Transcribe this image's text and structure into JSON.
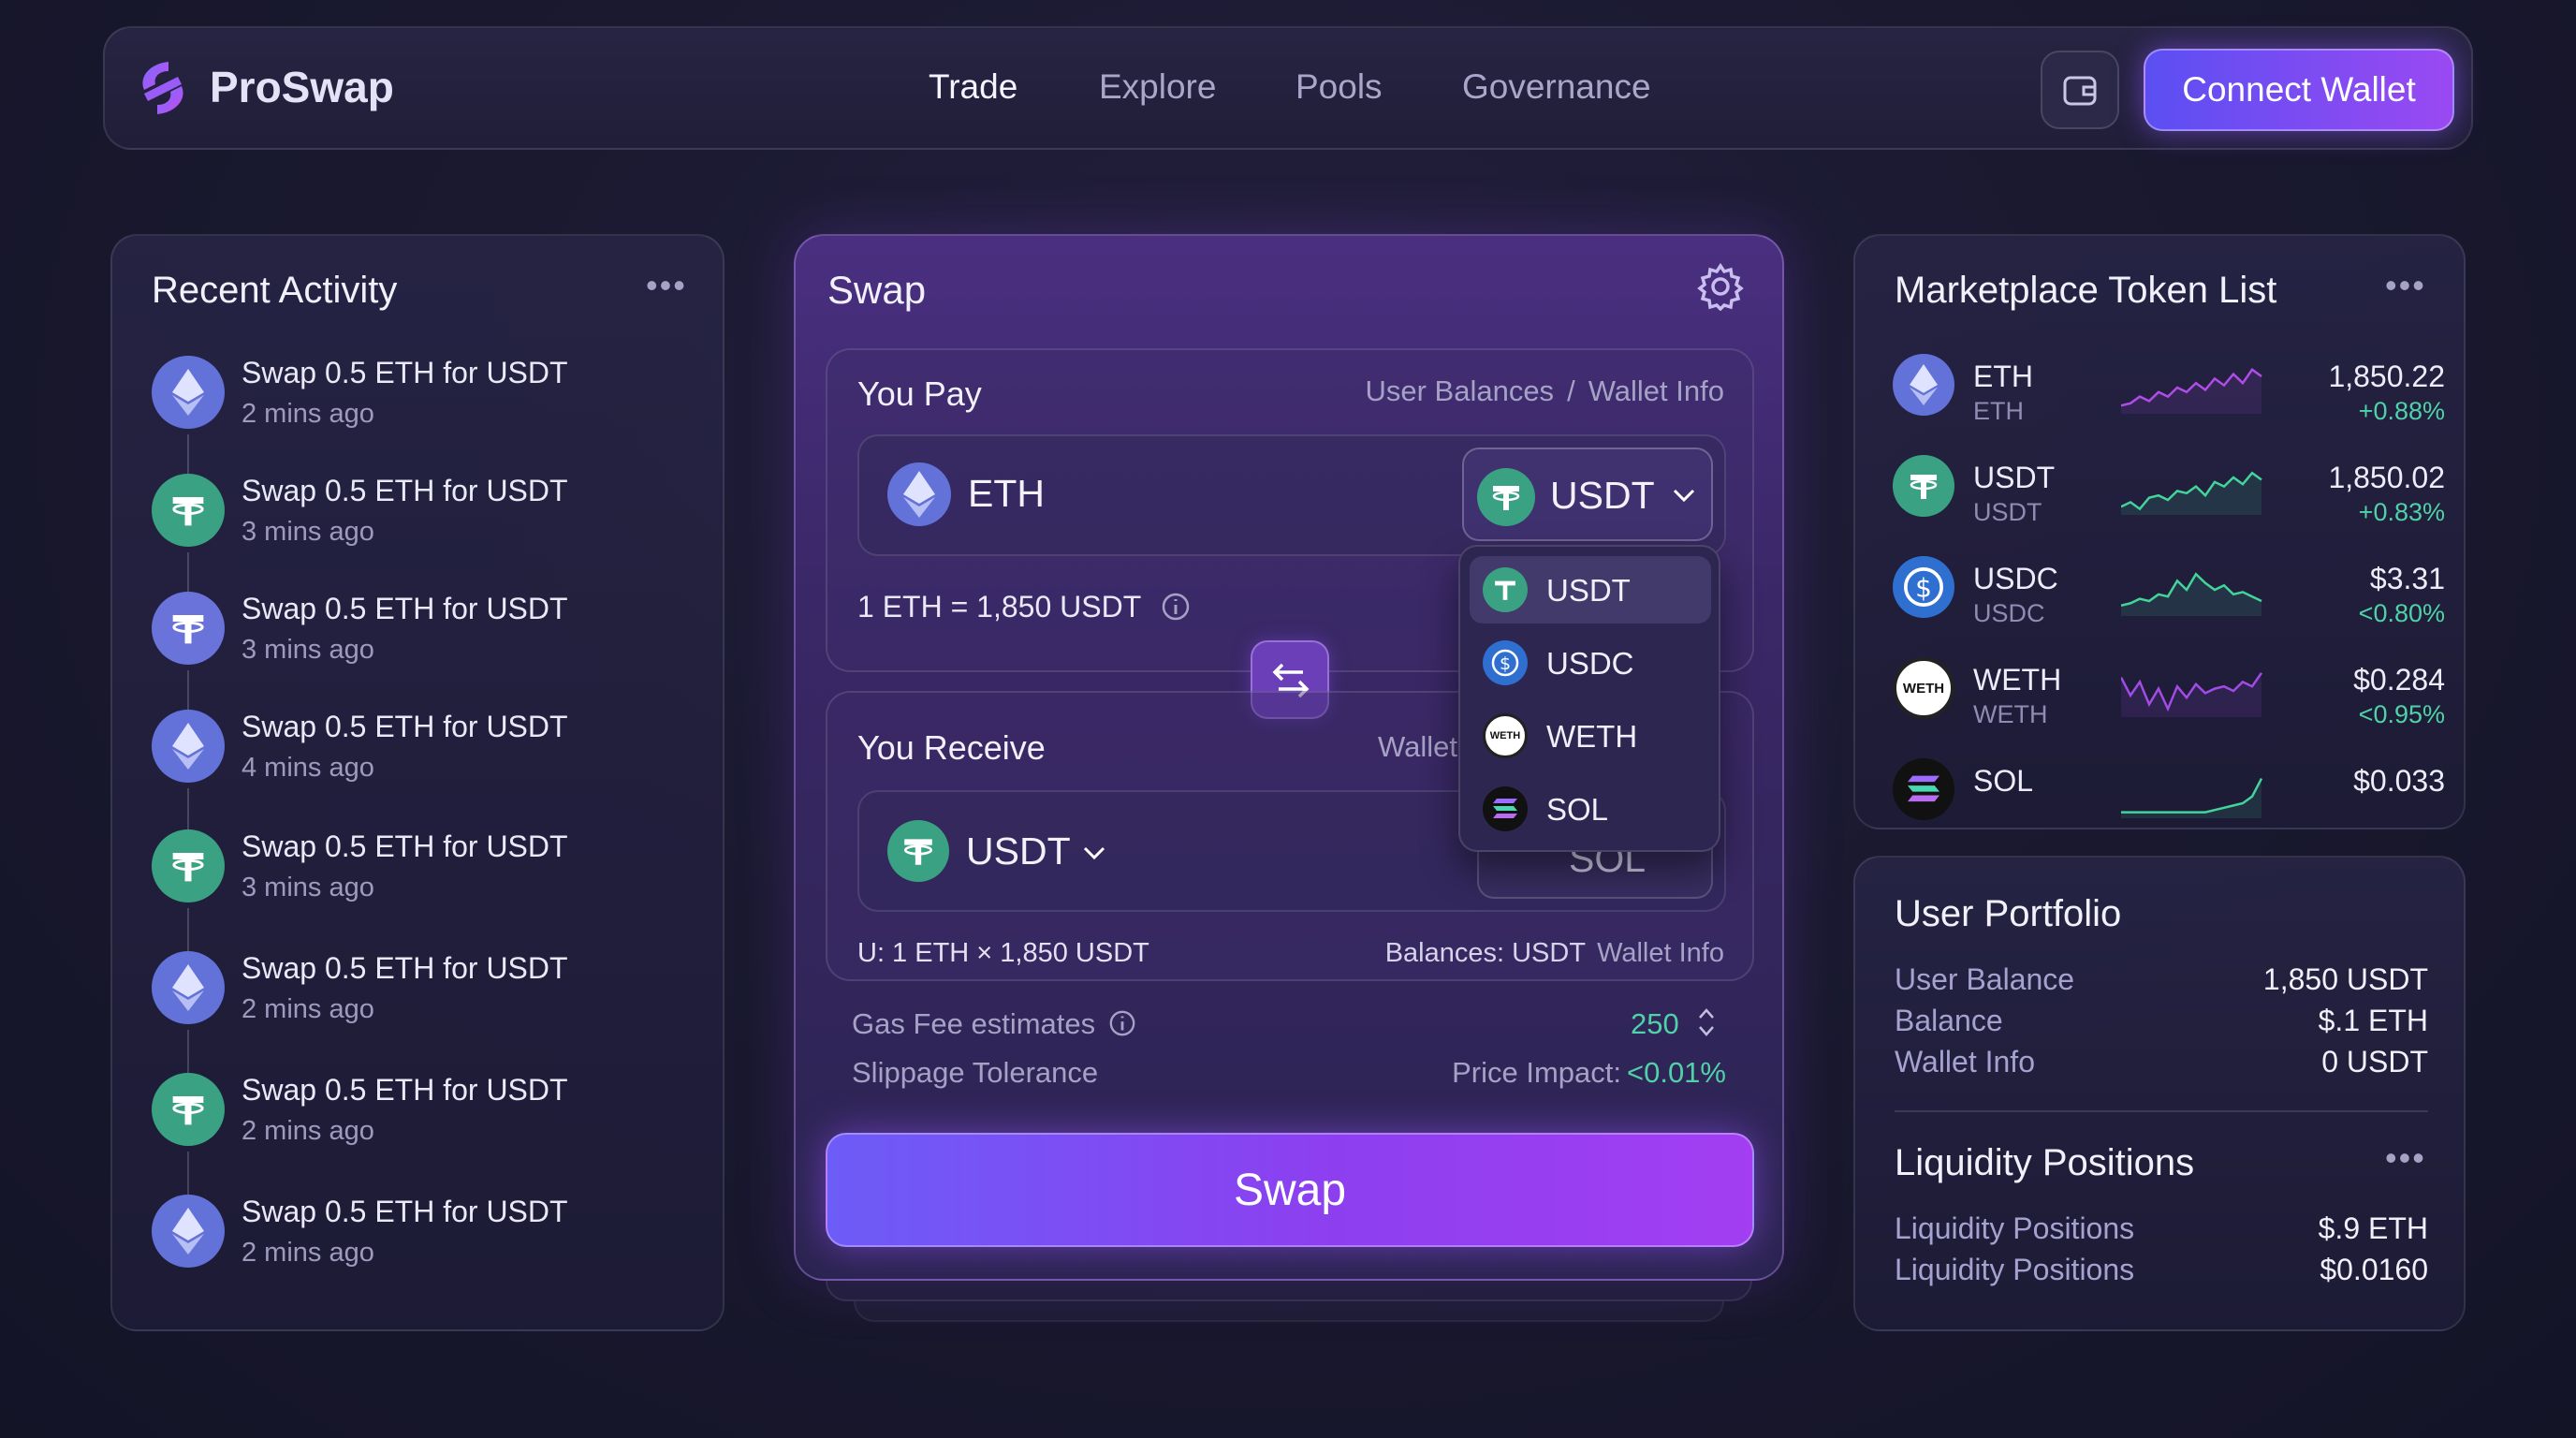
{
  "header": {
    "brand": "ProSwap",
    "nav": [
      "Trade",
      "Explore",
      "Pools",
      "Governance"
    ],
    "active_nav": "Trade",
    "connect_label": "Connect Wallet"
  },
  "activity": {
    "title": "Recent Activity",
    "items": [
      {
        "icon": "eth",
        "title": "Swap 0.5 ETH for USDT",
        "time": "2 mins ago"
      },
      {
        "icon": "usdt",
        "title": "Swap 0.5 ETH for USDT",
        "time": "3 mins ago"
      },
      {
        "icon": "usdt-alt",
        "title": "Swap 0.5 ETH for USDT",
        "time": "3 mins ago"
      },
      {
        "icon": "eth",
        "title": "Swap 0.5 ETH for USDT",
        "time": "4 mins ago"
      },
      {
        "icon": "usdt",
        "title": "Swap 0.5 ETH for USDT",
        "time": "3 mins ago"
      },
      {
        "icon": "eth",
        "title": "Swap 0.5 ETH for USDT",
        "time": "2 mins ago"
      },
      {
        "icon": "usdt",
        "title": "Swap 0.5 ETH for USDT",
        "time": "2 mins ago"
      },
      {
        "icon": "eth",
        "title": "Swap 0.5 ETH for USDT",
        "time": "2 mins ago"
      }
    ]
  },
  "swap": {
    "title": "Swap",
    "pay": {
      "label": "You Pay",
      "meta_left": "User Balances",
      "meta_sep": "/",
      "meta_right": "Wallet Info",
      "token": "ETH",
      "selected": "USDT",
      "rate": "1 ETH = 1,850 USDT"
    },
    "dropdown": {
      "options": [
        "USDT",
        "USDC",
        "WETH",
        "SOL"
      ],
      "selected": "USDT"
    },
    "receive": {
      "label": "You Receive",
      "meta": "Wallet",
      "token": "USDT",
      "behind_token": "SOL",
      "footer_left": "U: 1 ETH × 1,850 USDT",
      "footer_right_a": "Balances: USDT",
      "footer_right_b": "Wallet Info"
    },
    "gas_label": "Gas Fee estimates",
    "gas_value": "250",
    "slippage_label": "Slippage Tolerance",
    "impact_label": "Price Impact:",
    "impact_value": "<0.01%",
    "button": "Swap"
  },
  "tokens": {
    "title": "Marketplace Token List",
    "items": [
      {
        "symbol": "ETH",
        "sub": "ETH",
        "price": "1,850.22",
        "change": "+0.88%",
        "spark_color": "#b04de8"
      },
      {
        "symbol": "USDT",
        "sub": "USDT",
        "price": "1,850.02",
        "change": "+0.83%",
        "spark_color": "#43d49b"
      },
      {
        "symbol": "USDC",
        "sub": "USDC",
        "price": "$3.31",
        "change": "<0.80%",
        "spark_color": "#43d49b"
      },
      {
        "symbol": "WETH",
        "sub": "WETH",
        "price": "$0.284",
        "change": "<0.95%",
        "spark_color": "#a24ce6"
      },
      {
        "symbol": "SOL",
        "sub": "",
        "price": "$0.033",
        "change": "",
        "spark_color": "#43d49b"
      }
    ]
  },
  "portfolio": {
    "title": "User Portfolio",
    "rows": [
      {
        "label": "User Balance",
        "value": "1,850 USDT"
      },
      {
        "label": "Balance",
        "value": "$.1 ETH"
      },
      {
        "label": "Wallet Info",
        "value": "0 USDT"
      }
    ],
    "lp_title": "Liquidity Positions",
    "lp_rows": [
      {
        "label": "Liquidity Positions",
        "value": "$.9 ETH"
      },
      {
        "label": "Liquidity Positions",
        "value": "$0.0160"
      }
    ]
  },
  "colors": {
    "accent": "#8d3ff0",
    "positive": "#4fd2a8",
    "usdt": "#3aa283",
    "eth": "#6272d8"
  }
}
